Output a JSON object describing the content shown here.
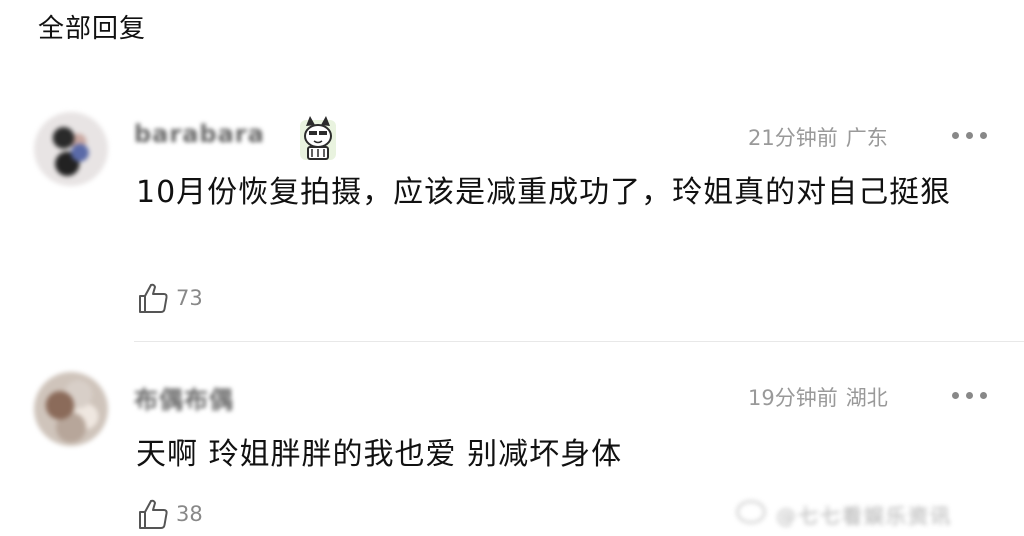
{
  "header": {
    "title": "全部回复"
  },
  "comments": [
    {
      "username": "barabara",
      "time": "21分钟前",
      "location": "广东",
      "content": "10月份恢复拍摄，应该是减重成功了，玲姐真的对自己挺狠",
      "likes": "73",
      "avatar_icon": "avatar",
      "has_badge": true,
      "badge_icon": "cat-sticker-icon"
    },
    {
      "username": "布偶布偶",
      "time": "19分钟前",
      "location": "湖北",
      "content": "天啊 玲姐胖胖的我也爱 别减坏身体",
      "likes": "38",
      "avatar_icon": "avatar",
      "has_badge": false
    }
  ],
  "icons": {
    "more": "more-options-icon",
    "like": "thumbs-up-icon"
  },
  "watermark": {
    "text": "@七七看娱乐资讯"
  },
  "colors": {
    "meta_text": "#999999",
    "content_text": "#111111",
    "divider": "#e8e8e8"
  }
}
